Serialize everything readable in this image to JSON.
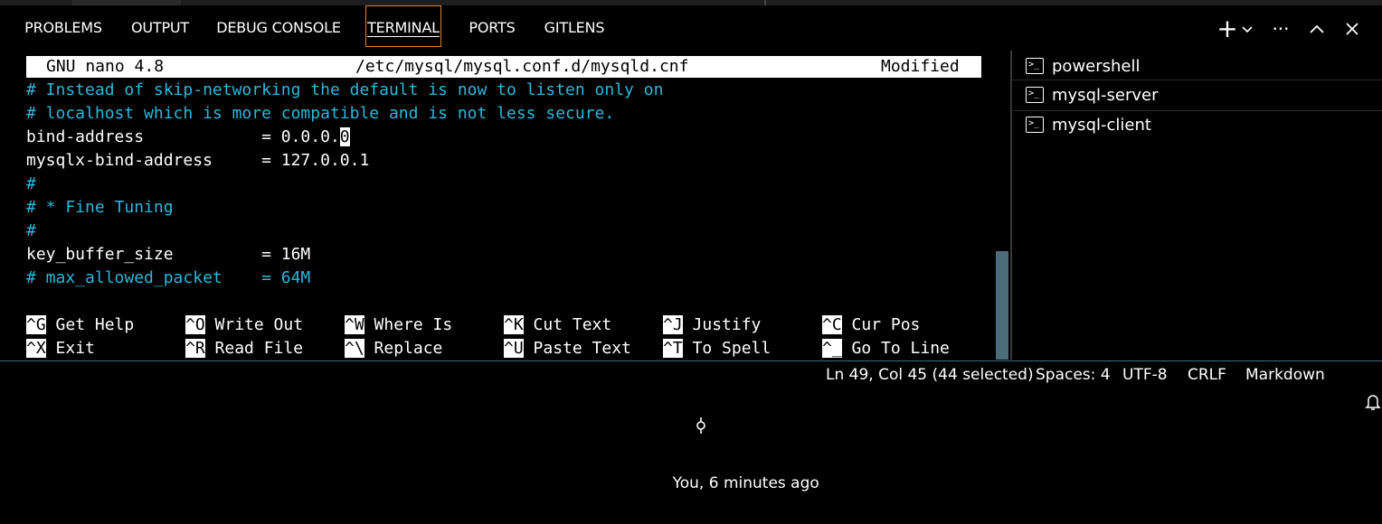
{
  "panel": {
    "tabs": [
      {
        "label": "PROBLEMS"
      },
      {
        "label": "OUTPUT"
      },
      {
        "label": "DEBUG CONSOLE"
      },
      {
        "label": "TERMINAL"
      },
      {
        "label": "PORTS"
      },
      {
        "label": "GITLENS"
      }
    ],
    "active_tab": "TERMINAL",
    "icons": {
      "add": "plus-icon",
      "dropdown": "chevron-down-icon",
      "more": "more-icon",
      "maximize": "chevron-up-icon",
      "close": "close-icon"
    },
    "accent_color": "#d7803b"
  },
  "nano": {
    "title_left": "GNU nano 4.8",
    "title_center": "/etc/mysql/mysql.conf.d/mysqld.cnf",
    "title_right": "Modified",
    "lines": [
      "# Instead of skip-networking the default is now to listen only on",
      "# localhost which is more compatible and is not less secure.",
      "bind-address            = 0.0.0.",
      "mysqlx-bind-address     = 127.0.0.1",
      "#",
      "# * Fine Tuning",
      "#",
      "key_buffer_size         = 16M",
      "# max_allowed_packet    = 64M"
    ],
    "cursor_char": "0",
    "shortcuts": [
      {
        "key": "^G",
        "label": " Get Help"
      },
      {
        "key": "^O",
        "label": " Write Out"
      },
      {
        "key": "^W",
        "label": " Where Is"
      },
      {
        "key": "^K",
        "label": " Cut Text"
      },
      {
        "key": "^J",
        "label": " Justify"
      },
      {
        "key": "^C",
        "label": " Cur Pos"
      },
      {
        "key": "^X",
        "label": " Exit"
      },
      {
        "key": "^R",
        "label": " Read File"
      },
      {
        "key": "^\\",
        "label": " Replace"
      },
      {
        "key": "^U",
        "label": " Paste Text"
      },
      {
        "key": "^T",
        "label": " To Spell"
      },
      {
        "key": "^_",
        "label": " Go To Line"
      }
    ],
    "comment_color": "#29b8db"
  },
  "terminals": [
    {
      "label": "powershell",
      "icon": "terminal-icon"
    },
    {
      "label": "mysql-server",
      "icon": "terminal-icon",
      "selected": true
    },
    {
      "label": "mysql-client",
      "icon": "terminal-icon"
    }
  ],
  "statusbar": {
    "blame": "You, 6 minutes ago",
    "position": "Ln 49, Col 45 (44 selected)",
    "spaces": "Spaces: 4",
    "encoding": "UTF-8",
    "eol": "CRLF",
    "language": "Markdown",
    "icons": {
      "blame": "git-commit-icon",
      "notifications": "bell-icon"
    }
  }
}
